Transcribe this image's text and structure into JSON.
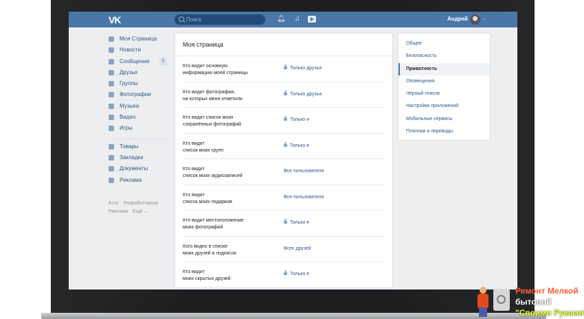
{
  "header": {
    "logo": "VK",
    "search_placeholder": "Поиск",
    "user_name": "Андрей",
    "icons": [
      "bell-icon",
      "music-icon",
      "video-play-icon"
    ]
  },
  "left_menu": {
    "items": [
      {
        "label": "Моя Страница",
        "icon": "home-icon"
      },
      {
        "label": "Новости",
        "icon": "news-icon"
      },
      {
        "label": "Сообщения",
        "icon": "messages-icon",
        "badge": "5"
      },
      {
        "label": "Друзья",
        "icon": "friends-icon"
      },
      {
        "label": "Группы",
        "icon": "groups-icon"
      },
      {
        "label": "Фотографии",
        "icon": "camera-icon"
      },
      {
        "label": "Музыка",
        "icon": "music-icon"
      },
      {
        "label": "Видео",
        "icon": "video-icon"
      },
      {
        "label": "Игры",
        "icon": "games-icon"
      }
    ],
    "items2": [
      {
        "label": "Товары",
        "icon": "shop-icon"
      },
      {
        "label": "Закладки",
        "icon": "bookmark-icon"
      },
      {
        "label": "Документы",
        "icon": "document-icon"
      },
      {
        "label": "Реклама",
        "icon": "ads-icon"
      }
    ],
    "footer": {
      "blog": "Блог",
      "devs": "Разработчикам",
      "ads": "Реклама",
      "more": "Ещё ⌄"
    }
  },
  "main": {
    "title": "Моя страница",
    "rows": [
      {
        "q1": "Кто видит основную",
        "q2": "информацию моей страницы",
        "a": "Только друзья",
        "lock": true
      },
      {
        "q1": "Кто видит фотографии,",
        "q2": "на которых меня отметили",
        "a": "Только друзья",
        "lock": true
      },
      {
        "q1": "Кто видит список моих",
        "q2": "сохранённых фотографий",
        "a": "Только я",
        "lock": true
      },
      {
        "q1": "Кто видит",
        "q2": "список моих групп",
        "a": "Только я",
        "lock": true
      },
      {
        "q1": "Кто видит",
        "q2": "список моих аудиозаписей",
        "a": "Все пользователи",
        "lock": false
      },
      {
        "q1": "Кто видит",
        "q2": "список моих подарков",
        "a": "Все пользователи",
        "lock": false
      },
      {
        "q1": "Кто видит местоположение",
        "q2": "моих фотографий",
        "a": "Только я",
        "lock": true
      },
      {
        "q1": "Кого видно в списке",
        "q2": "моих друзей и подписок",
        "a": "Всех друзей",
        "lock": false
      },
      {
        "q1": "Кто видит",
        "q2": "моих скрытых друзей",
        "a": "Только я",
        "lock": true
      }
    ]
  },
  "right_menu": {
    "items": [
      "Общее",
      "Безопасность",
      "Приватность",
      "Оповещения",
      "Чёрный список",
      "Настройки приложений",
      "Мобильные сервисы",
      "Платежи и переводы"
    ],
    "active_index": 2
  },
  "watermark": {
    "line1": "Ремонт Мелкой",
    "line2": "бытовой",
    "line3": "\"Своими Руками\""
  },
  "colors": {
    "header": "#4a76a8",
    "link": "#2a5885",
    "background": "#edeef0"
  }
}
